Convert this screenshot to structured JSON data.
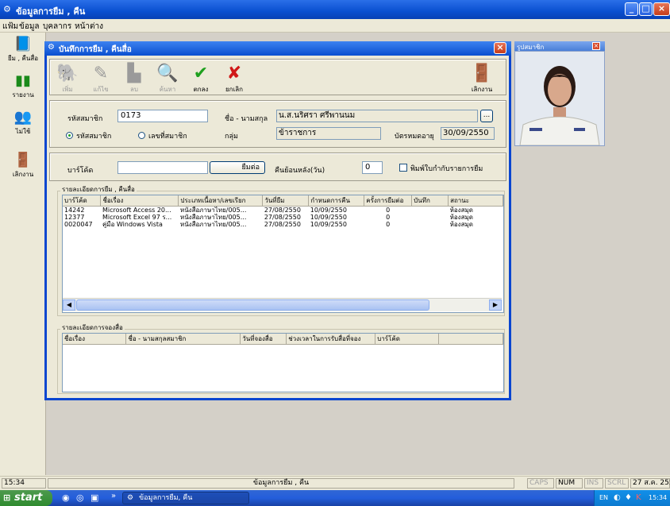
{
  "app": {
    "title": "ข้อมูลการยืม , คืน"
  },
  "menu": [
    "แฟ้ม",
    "ข้อมูล",
    "บุคลากร",
    "หน้าต่าง"
  ],
  "sidebar": [
    {
      "label": "ยืม , คืนสื่อ"
    },
    {
      "label": "รายงาน"
    },
    {
      "label": "ไม่ใช้"
    },
    {
      "label": "เลิกงาน"
    }
  ],
  "dialog": {
    "title": "บันทึกการยืม , คืนสื่อ",
    "toolbar": [
      {
        "label": "เพิ่ม"
      },
      {
        "label": "แก้ไข"
      },
      {
        "label": "ลบ"
      },
      {
        "label": "ค้นหา"
      },
      {
        "label": "ตกลง"
      },
      {
        "label": "ยกเลิก"
      }
    ],
    "exit_label": "เลิกงาน",
    "member": {
      "id_label": "รหัสสมาชิก",
      "id_value": "0173",
      "name_label": "ชื่อ - นามสกุล",
      "name_value": "น.ส.นริศรา ศรีพานนม",
      "browse_label": "...",
      "radio_id": "รหัสสมาชิก",
      "radio_no": "เลขที่สมาชิก",
      "group_label": "กลุ่ม",
      "group_value": "ข้าราชการ",
      "expiry_label": "บัตรหมดอายุ",
      "expiry_value": "30/09/2550"
    },
    "barcode": {
      "label": "บาร์โค้ด",
      "value": "",
      "borrow_button": "ยืมต่อ",
      "return_after_label": "คืนย้อนหลัง(วัน)",
      "return_after_value": "0",
      "print_label": "พิมพ์ใบกำกับรายการยืม"
    },
    "loans": {
      "caption": "รายละเอียดการยืม , คืนสื่อ",
      "columns": [
        "บาร์โค้ด",
        "ชื่อเรื่อง",
        "ประเภทเนื้อหา/เลขเรียก",
        "วันที่ยืม",
        "กำหนดการคืน",
        "ครั้งการยืมต่อ",
        "บันทึก",
        "สถานะ"
      ],
      "rows": [
        [
          "14242",
          "Microsoft Access 20...",
          "หนังสือภาษาไทย/005...",
          "27/08/2550",
          "10/09/2550",
          "0",
          "",
          "ห้องสมุด"
        ],
        [
          "12377",
          "Microsoft Excel 97 ร...",
          "หนังสือภาษาไทย/005...",
          "27/08/2550",
          "10/09/2550",
          "0",
          "",
          "ห้องสมุด"
        ],
        [
          "0020047",
          "คู่มือ Windows Vista",
          "หนังสือภาษาไทย/005...",
          "27/08/2550",
          "10/09/2550",
          "0",
          "",
          "ห้องสมุด"
        ]
      ]
    },
    "reservations": {
      "caption": "รายละเอียดการจองสื่อ",
      "columns": [
        "ชื่อเรื่อง",
        "ชื่อ - นามสกุลสมาชิก",
        "วันที่จองสื่อ",
        "ช่วงเวลาในการรับสื่อที่จอง",
        "บาร์โค้ด"
      ]
    }
  },
  "photo": {
    "title": "รูปสมาชิก"
  },
  "statusbar": {
    "time": "15:34",
    "center": "ข้อมูลการยืม , คืน",
    "caps": "CAPS",
    "num": "NUM",
    "ins": "INS",
    "scrl": "SCRL",
    "date": "27 ส.ค. 2550"
  },
  "taskbar": {
    "start": "start",
    "task": "ข้อมูลการยืม, คืน",
    "lang": "EN",
    "clock": "15:34"
  }
}
